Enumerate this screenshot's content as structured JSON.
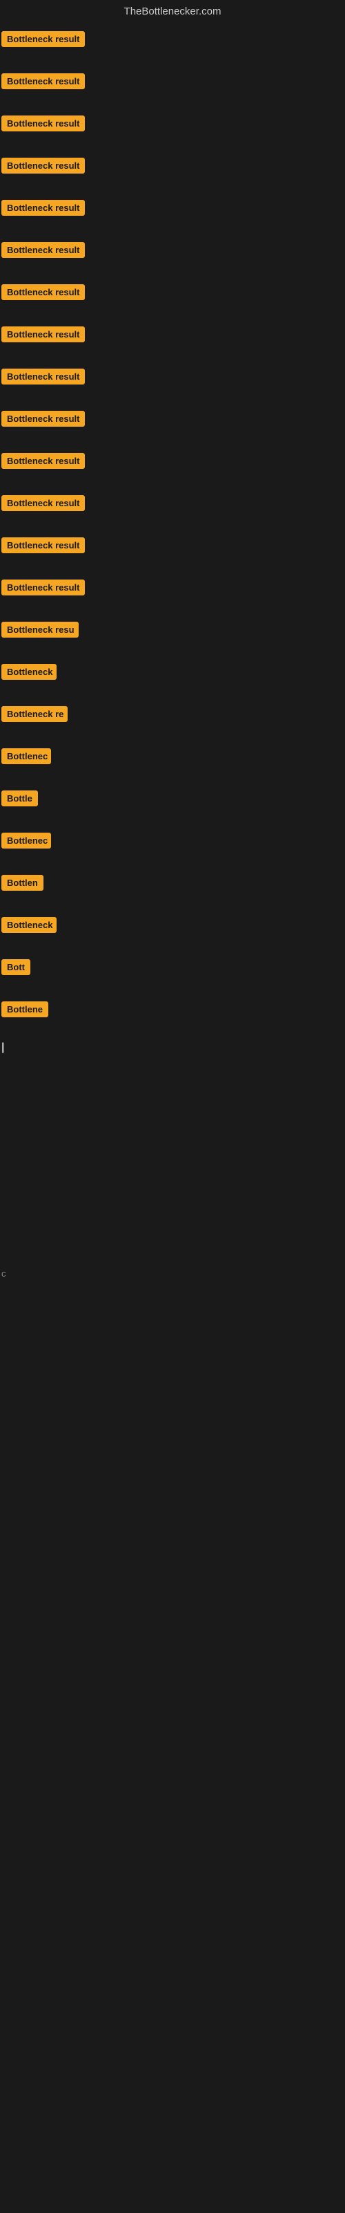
{
  "header": {
    "title": "TheBottlenecker.com"
  },
  "items": [
    {
      "label": "Bottleneck result",
      "width": 140,
      "marginBottom": 30
    },
    {
      "label": "Bottleneck result",
      "width": 138,
      "marginBottom": 30
    },
    {
      "label": "Bottleneck result",
      "width": 136,
      "marginBottom": 30
    },
    {
      "label": "Bottleneck result",
      "width": 135,
      "marginBottom": 30
    },
    {
      "label": "Bottleneck result",
      "width": 135,
      "marginBottom": 30
    },
    {
      "label": "Bottleneck result",
      "width": 134,
      "marginBottom": 30
    },
    {
      "label": "Bottleneck result",
      "width": 133,
      "marginBottom": 30
    },
    {
      "label": "Bottleneck result",
      "width": 132,
      "marginBottom": 30
    },
    {
      "label": "Bottleneck result",
      "width": 131,
      "marginBottom": 30
    },
    {
      "label": "Bottleneck result",
      "width": 130,
      "marginBottom": 30
    },
    {
      "label": "Bottleneck result",
      "width": 130,
      "marginBottom": 30
    },
    {
      "label": "Bottleneck result",
      "width": 130,
      "marginBottom": 30
    },
    {
      "label": "Bottleneck result",
      "width": 130,
      "marginBottom": 30
    },
    {
      "label": "Bottleneck result",
      "width": 130,
      "marginBottom": 30
    },
    {
      "label": "Bottleneck resu",
      "width": 112,
      "marginBottom": 30
    },
    {
      "label": "Bottleneck",
      "width": 80,
      "marginBottom": 30
    },
    {
      "label": "Bottleneck re",
      "width": 96,
      "marginBottom": 30
    },
    {
      "label": "Bottlenec",
      "width": 72,
      "marginBottom": 30
    },
    {
      "label": "Bottle",
      "width": 54,
      "marginBottom": 30
    },
    {
      "label": "Bottlenec",
      "width": 72,
      "marginBottom": 30
    },
    {
      "label": "Bottlen",
      "width": 62,
      "marginBottom": 30
    },
    {
      "label": "Bottleneck",
      "width": 80,
      "marginBottom": 30
    },
    {
      "label": "Bott",
      "width": 46,
      "marginBottom": 30
    },
    {
      "label": "Bottlene",
      "width": 68,
      "marginBottom": 30
    }
  ],
  "cursor": {
    "char": "|"
  },
  "bottom_text": {
    "char": "c"
  }
}
